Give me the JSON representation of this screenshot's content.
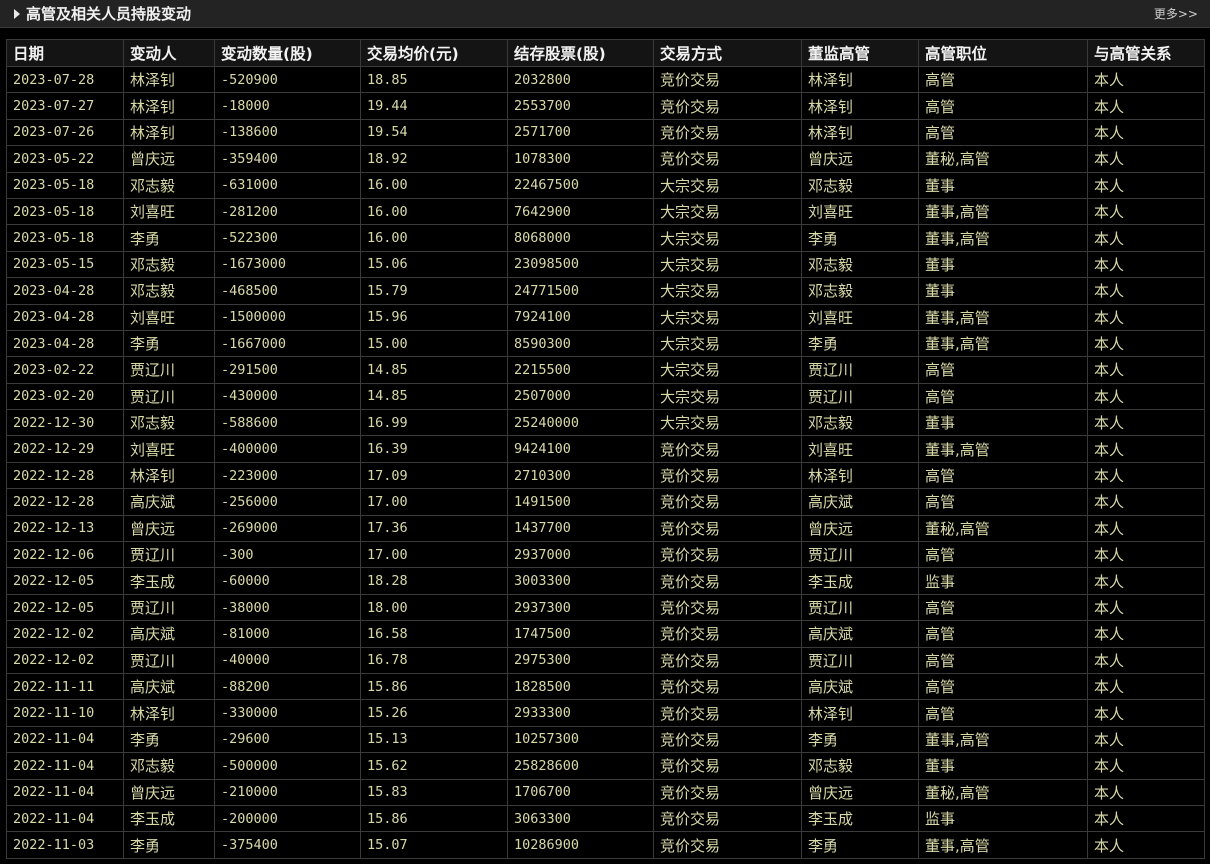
{
  "header": {
    "title": "高管及相关人员持股变动",
    "more": "更多>>"
  },
  "columns": [
    "日期",
    "变动人",
    "变动数量(股)",
    "交易均价(元)",
    "结存股票(股)",
    "交易方式",
    "董监高管",
    "高管职位",
    "与高管关系"
  ],
  "rows": [
    [
      "2023-07-28",
      "林泽钊",
      "-520900",
      "18.85",
      "2032800",
      "竞价交易",
      "林泽钊",
      "高管",
      "本人"
    ],
    [
      "2023-07-27",
      "林泽钊",
      "-18000",
      "19.44",
      "2553700",
      "竞价交易",
      "林泽钊",
      "高管",
      "本人"
    ],
    [
      "2023-07-26",
      "林泽钊",
      "-138600",
      "19.54",
      "2571700",
      "竞价交易",
      "林泽钊",
      "高管",
      "本人"
    ],
    [
      "2023-05-22",
      "曾庆远",
      "-359400",
      "18.92",
      "1078300",
      "竞价交易",
      "曾庆远",
      "董秘,高管",
      "本人"
    ],
    [
      "2023-05-18",
      "邓志毅",
      "-631000",
      "16.00",
      "22467500",
      "大宗交易",
      "邓志毅",
      "董事",
      "本人"
    ],
    [
      "2023-05-18",
      "刘喜旺",
      "-281200",
      "16.00",
      "7642900",
      "大宗交易",
      "刘喜旺",
      "董事,高管",
      "本人"
    ],
    [
      "2023-05-18",
      "李勇",
      "-522300",
      "16.00",
      "8068000",
      "大宗交易",
      "李勇",
      "董事,高管",
      "本人"
    ],
    [
      "2023-05-15",
      "邓志毅",
      "-1673000",
      "15.06",
      "23098500",
      "大宗交易",
      "邓志毅",
      "董事",
      "本人"
    ],
    [
      "2023-04-28",
      "邓志毅",
      "-468500",
      "15.79",
      "24771500",
      "大宗交易",
      "邓志毅",
      "董事",
      "本人"
    ],
    [
      "2023-04-28",
      "刘喜旺",
      "-1500000",
      "15.96",
      "7924100",
      "大宗交易",
      "刘喜旺",
      "董事,高管",
      "本人"
    ],
    [
      "2023-04-28",
      "李勇",
      "-1667000",
      "15.00",
      "8590300",
      "大宗交易",
      "李勇",
      "董事,高管",
      "本人"
    ],
    [
      "2023-02-22",
      "贾辽川",
      "-291500",
      "14.85",
      "2215500",
      "大宗交易",
      "贾辽川",
      "高管",
      "本人"
    ],
    [
      "2023-02-20",
      "贾辽川",
      "-430000",
      "14.85",
      "2507000",
      "大宗交易",
      "贾辽川",
      "高管",
      "本人"
    ],
    [
      "2022-12-30",
      "邓志毅",
      "-588600",
      "16.99",
      "25240000",
      "大宗交易",
      "邓志毅",
      "董事",
      "本人"
    ],
    [
      "2022-12-29",
      "刘喜旺",
      "-400000",
      "16.39",
      "9424100",
      "竞价交易",
      "刘喜旺",
      "董事,高管",
      "本人"
    ],
    [
      "2022-12-28",
      "林泽钊",
      "-223000",
      "17.09",
      "2710300",
      "竞价交易",
      "林泽钊",
      "高管",
      "本人"
    ],
    [
      "2022-12-28",
      "高庆斌",
      "-256000",
      "17.00",
      "1491500",
      "竞价交易",
      "高庆斌",
      "高管",
      "本人"
    ],
    [
      "2022-12-13",
      "曾庆远",
      "-269000",
      "17.36",
      "1437700",
      "竞价交易",
      "曾庆远",
      "董秘,高管",
      "本人"
    ],
    [
      "2022-12-06",
      "贾辽川",
      "-300",
      "17.00",
      "2937000",
      "竞价交易",
      "贾辽川",
      "高管",
      "本人"
    ],
    [
      "2022-12-05",
      "李玉成",
      "-60000",
      "18.28",
      "3003300",
      "竞价交易",
      "李玉成",
      "监事",
      "本人"
    ],
    [
      "2022-12-05",
      "贾辽川",
      "-38000",
      "18.00",
      "2937300",
      "竞价交易",
      "贾辽川",
      "高管",
      "本人"
    ],
    [
      "2022-12-02",
      "高庆斌",
      "-81000",
      "16.58",
      "1747500",
      "竞价交易",
      "高庆斌",
      "高管",
      "本人"
    ],
    [
      "2022-12-02",
      "贾辽川",
      "-40000",
      "16.78",
      "2975300",
      "竞价交易",
      "贾辽川",
      "高管",
      "本人"
    ],
    [
      "2022-11-11",
      "高庆斌",
      "-88200",
      "15.86",
      "1828500",
      "竞价交易",
      "高庆斌",
      "高管",
      "本人"
    ],
    [
      "2022-11-10",
      "林泽钊",
      "-330000",
      "15.26",
      "2933300",
      "竞价交易",
      "林泽钊",
      "高管",
      "本人"
    ],
    [
      "2022-11-04",
      "李勇",
      "-29600",
      "15.13",
      "10257300",
      "竞价交易",
      "李勇",
      "董事,高管",
      "本人"
    ],
    [
      "2022-11-04",
      "邓志毅",
      "-500000",
      "15.62",
      "25828600",
      "竞价交易",
      "邓志毅",
      "董事",
      "本人"
    ],
    [
      "2022-11-04",
      "曾庆远",
      "-210000",
      "15.83",
      "1706700",
      "竞价交易",
      "曾庆远",
      "董秘,高管",
      "本人"
    ],
    [
      "2022-11-04",
      "李玉成",
      "-200000",
      "15.86",
      "3063300",
      "竞价交易",
      "李玉成",
      "监事",
      "本人"
    ],
    [
      "2022-11-03",
      "李勇",
      "-375400",
      "15.07",
      "10286900",
      "竞价交易",
      "李勇",
      "董事,高管",
      "本人"
    ]
  ],
  "colors": {
    "background": "#000000",
    "header_bar": "#232323",
    "cell_text": "#d9d9a8",
    "header_text": "#f2f2f2",
    "grid": "#3a3a3a"
  }
}
